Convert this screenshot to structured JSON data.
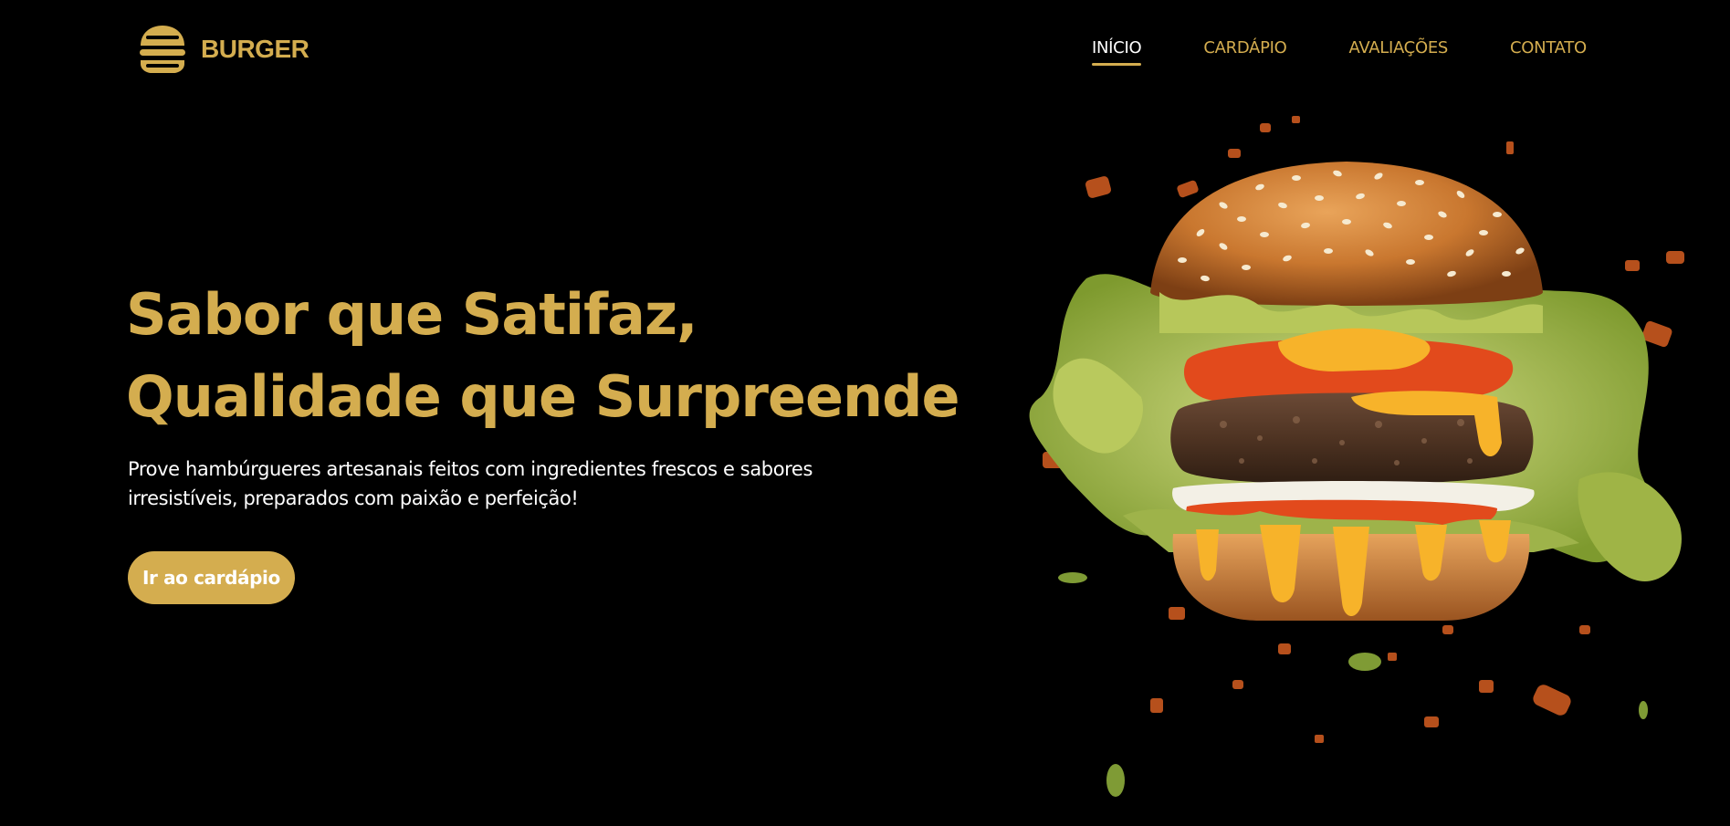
{
  "header": {
    "logo_text": "BURGER",
    "nav": [
      {
        "label": "INÍCIO",
        "active": true
      },
      {
        "label": "CARDÁPIO",
        "active": false
      },
      {
        "label": "AVALIAÇÕES",
        "active": false
      },
      {
        "label": "CONTATO",
        "active": false
      }
    ]
  },
  "hero": {
    "title_line1": "Sabor que Satifaz,",
    "title_line2": "Qualidade que Surpreende",
    "description": "Prove hambúrgueres artesanais feitos com ingredientes frescos e sabores irresistíveis, preparados com paixão e perfeição!",
    "button_label": "Ir ao cardápio",
    "image_icon": "burger-image"
  },
  "colors": {
    "background": "#000000",
    "accent": "#d4ad4f",
    "text": "#ffffff"
  }
}
